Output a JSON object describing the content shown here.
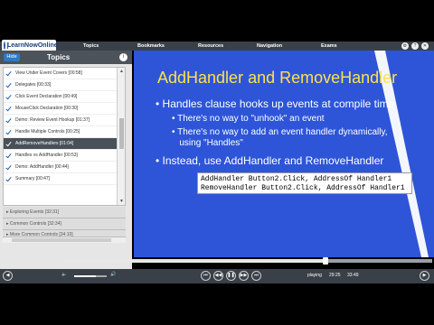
{
  "app": {
    "logo_text": "LearnNowOnline"
  },
  "nav": {
    "items": [
      "Topics",
      "Bookmarks",
      "Resources",
      "Navigation",
      "Exams"
    ]
  },
  "sidebar": {
    "hide_label": "Hide",
    "title": "Topics",
    "lessons": [
      {
        "label": "View Under Event Covers [00:58]",
        "active": false
      },
      {
        "label": "Delegates [00:33]",
        "active": false
      },
      {
        "label": "Click Event Declaration [00:49]",
        "active": false
      },
      {
        "label": "MouseClick Declaration [00:30]",
        "active": false
      },
      {
        "label": "Demo: Review Event Hookup [01:37]",
        "active": false
      },
      {
        "label": "Handle Multiple Controls [00:25]",
        "active": false
      },
      {
        "label": "AddRemoveHandlers [01:04]",
        "active": true
      },
      {
        "label": "Handles vs AddHandler [00:53]",
        "active": false
      },
      {
        "label": "Demo: AddHandler [00:44]",
        "active": false
      },
      {
        "label": "Summary [00:47]",
        "active": false
      }
    ],
    "modules": [
      "Exploring Events [32:31]",
      "Common Controls [32:34]",
      "More Common Controls [34:10]"
    ]
  },
  "slide": {
    "title": "AddHandler and RemoveHandler",
    "bullets": [
      "Handles clause hooks up events at compile time",
      "There's no way to \"unhook\" an event",
      "There's no way to add an event handler dynamically,",
      "using \"Handles\"",
      "Instead, use AddHandler and RemoveHandler"
    ],
    "code_line1": "AddHandler Button2.Click, AddressOf Handler1",
    "code_line2": "RemoveHandler Button2.Click, AddressOf Handler1"
  },
  "player": {
    "state": "playing",
    "current_time": "29:25",
    "total_time": "33:49",
    "progress_fraction": 0.71,
    "volume_fraction": 0.67
  }
}
